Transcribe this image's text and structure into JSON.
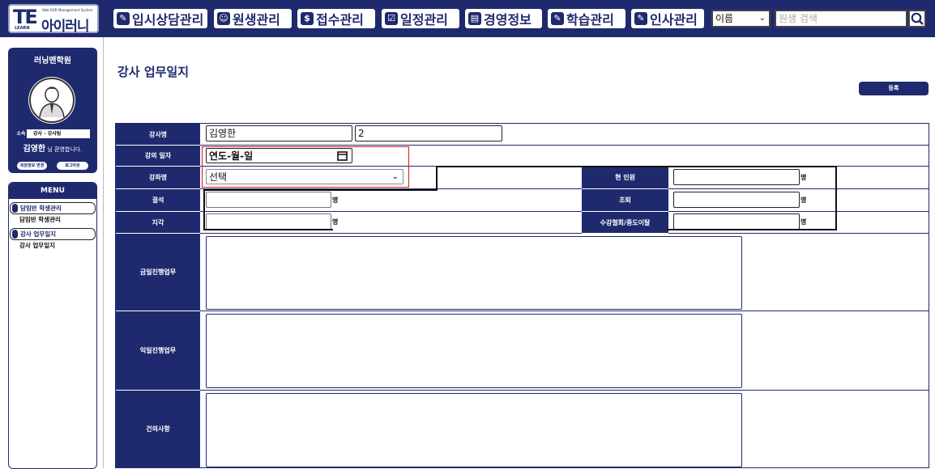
{
  "logo": {
    "mark": "TE",
    "learn": "LEARN",
    "system": "Web ROR Management System",
    "name": "아이러니"
  },
  "nav": [
    {
      "icon": "✎",
      "label": "입시상담관리"
    },
    {
      "icon": "☺",
      "label": "원생관리"
    },
    {
      "icon": "$",
      "label": "접수관리"
    },
    {
      "icon": "☑",
      "label": "일정관리"
    },
    {
      "icon": "▤",
      "label": "경영정보"
    },
    {
      "icon": "✎",
      "label": "학습관리"
    },
    {
      "icon": "✎",
      "label": "인사관리"
    }
  ],
  "search": {
    "select_value": "이름",
    "placeholder": "원생 검색"
  },
  "profile": {
    "academy": "러닝맨학원",
    "role_tag": "소속",
    "role": "강사 - 강사팀",
    "name": "김영한",
    "greeting_suffix": " 님 환영합니다.",
    "btn_info": "회원정보 변경",
    "btn_logout": "로그아웃"
  },
  "menu": {
    "title": "MENU",
    "groups": [
      {
        "label": "담임반 학생관리",
        "sub": "담임반 학생관리"
      },
      {
        "label": "강사 업무일지",
        "sub": "강사 업무일지"
      }
    ]
  },
  "page": {
    "title": "강사 업무일지",
    "register": "등록"
  },
  "form": {
    "teacher_label": "강사명",
    "teacher_name": "김영한",
    "teacher_extra": "2",
    "date_label": "강의 일자",
    "date_value": "연도-월-일",
    "class_label": "강좌명",
    "class_value": "선택",
    "absent_label": "결석",
    "late_label": "지각",
    "current_label": "현 인원",
    "early_label": "조퇴",
    "consult_label": "수강철회/중도이탈",
    "unit": "명",
    "today_label": "금일진행업무",
    "tomorrow_label": "익일진행업무",
    "suggest_label": "건의사항"
  }
}
